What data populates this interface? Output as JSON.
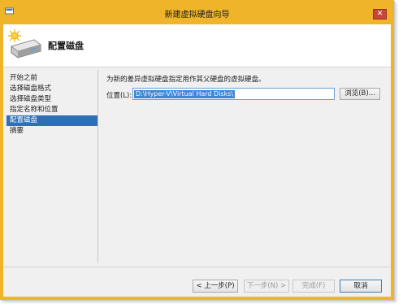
{
  "window": {
    "title": "新建虚拟硬盘向导",
    "close_glyph": "✕",
    "accent_color": "#f0b42a"
  },
  "header": {
    "title": "配置磁盘",
    "icon": "disk-sparkle-icon"
  },
  "nav": {
    "items": [
      {
        "label": "开始之前",
        "active": false
      },
      {
        "label": "选择磁盘格式",
        "active": false
      },
      {
        "label": "选择磁盘类型",
        "active": false
      },
      {
        "label": "指定名称和位置",
        "active": false
      },
      {
        "label": "配置磁盘",
        "active": true
      },
      {
        "label": "摘要",
        "active": false
      }
    ],
    "active_color": "#2f6fb5"
  },
  "main": {
    "instruction": "为新的差异虚拟硬盘指定用作其父硬盘的虚拟硬盘。",
    "location_label": "位置(L):",
    "location_value": "D:\\Hyper-V\\Virtual Hard Disks\\",
    "browse_label": "浏览(B)..."
  },
  "footer": {
    "prev_label": "< 上一步(P)",
    "next_label": "下一步(N) >",
    "finish_label": "完成(F)",
    "cancel_label": "取消"
  }
}
